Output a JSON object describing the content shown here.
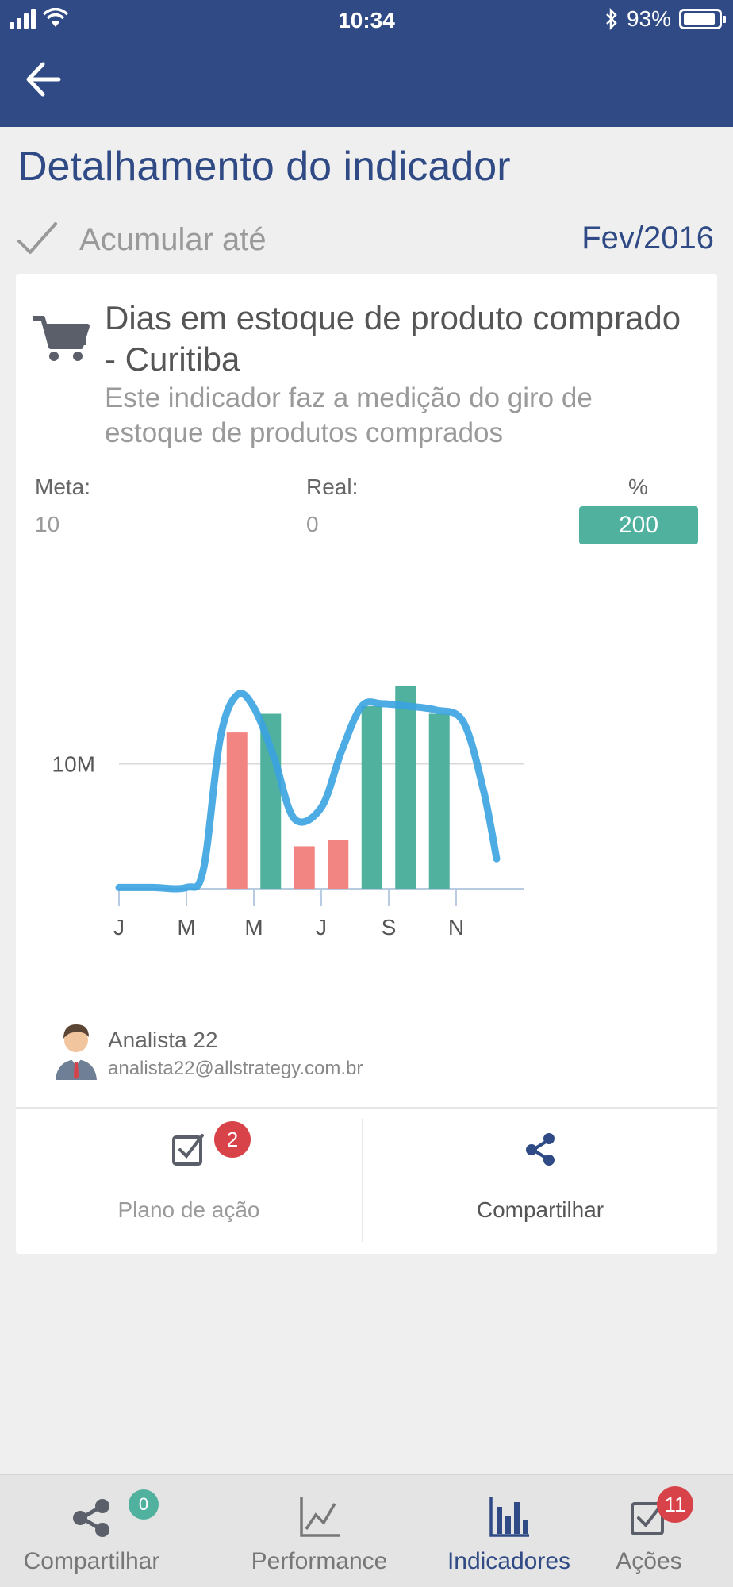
{
  "status_bar": {
    "time": "10:34",
    "battery": "93%",
    "battery_level": 0.93
  },
  "page": {
    "title": "Detalhamento do indicador"
  },
  "accumulate": {
    "label": "Acumular até",
    "checked": true,
    "period": "Fev/2016"
  },
  "indicator": {
    "icon": "shopping-cart-icon",
    "title": "Dias em estoque de produto comprado - Curitiba",
    "description": "Este indicador faz a medição do giro de estoque de produtos comprados",
    "meta_label": "Meta:",
    "meta_value": "10",
    "real_label": "Real:",
    "real_value": "0",
    "pct_label": "%",
    "pct_value": "200"
  },
  "colors": {
    "brand": "#2f4a85",
    "teal": "#4fb19e",
    "red": "#f28482",
    "line": "#3aa3e0",
    "badge_red": "#d8434a"
  },
  "chart_data": {
    "type": "bar",
    "x_tick_labels": [
      "J",
      "M",
      "M",
      "J",
      "S",
      "N"
    ],
    "y_tick_labels": [
      "10M"
    ],
    "y_ticks": [
      10
    ],
    "ylim": [
      0,
      20
    ],
    "xlim": [
      0,
      12
    ],
    "grid": true,
    "bars": [
      {
        "x": 3.5,
        "value": 12.5,
        "color": "red"
      },
      {
        "x": 4.5,
        "value": 14.0,
        "color": "teal"
      },
      {
        "x": 5.5,
        "value": 3.4,
        "color": "red"
      },
      {
        "x": 6.5,
        "value": 3.9,
        "color": "teal_red"
      },
      {
        "x": 7.5,
        "value": 14.6,
        "color": "teal"
      },
      {
        "x": 8.5,
        "value": 16.2,
        "color": "teal"
      },
      {
        "x": 9.5,
        "value": 14.0,
        "color": "teal"
      }
    ],
    "line": {
      "x": [
        0,
        1,
        2,
        2.5,
        3.0,
        3.5,
        4.0,
        4.6,
        5.2,
        6.0,
        6.6,
        7.2,
        7.8,
        8.6,
        9.4,
        10.2,
        10.8,
        11.2
      ],
      "y": [
        0.1,
        0.1,
        0.1,
        1.5,
        12.0,
        15.5,
        14.5,
        10.5,
        5.6,
        6.5,
        11.0,
        14.6,
        14.8,
        14.6,
        14.3,
        13.4,
        8.0,
        2.4
      ]
    }
  },
  "analyst": {
    "name": "Analista 22",
    "email": "analista22@allstrategy.com.br"
  },
  "actions": {
    "plan": {
      "label": "Plano de ação",
      "badge": "2"
    },
    "share": {
      "label": "Compartilhar"
    }
  },
  "tabs": [
    {
      "label": "Compartilhar",
      "icon": "share-icon",
      "badge": "0"
    },
    {
      "label": "Performance",
      "icon": "line-chart-icon"
    },
    {
      "label": "Indicadores",
      "icon": "bar-chart-icon",
      "active": true
    },
    {
      "label": "Ações",
      "icon": "checkbox-icon",
      "badge": "11"
    }
  ]
}
